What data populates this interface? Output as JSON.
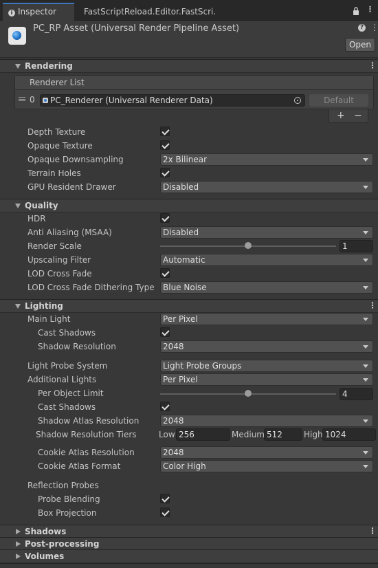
{
  "tabs": [
    {
      "label": "Inspector",
      "active": true
    },
    {
      "label": "FastScriptReload.Editor.FastScri.",
      "active": false
    }
  ],
  "header": {
    "title": "PC_RP Asset (Universal Render Pipeline Asset)",
    "open_label": "Open",
    "help_icon": "?",
    "menu_icon": "⋮"
  },
  "icons": {
    "info": "i",
    "lock": "🔒",
    "more": "⋮",
    "plus": "+",
    "minus": "−"
  },
  "rendering": {
    "title": "Rendering",
    "renderer_list_label": "Renderer List",
    "renderer_index": "0",
    "renderer_value": "PC_Renderer (Universal Renderer Data)",
    "default_label": "Default",
    "depth_texture_label": "Depth Texture",
    "depth_texture": true,
    "opaque_texture_label": "Opaque Texture",
    "opaque_texture": true,
    "opaque_downsampling_label": "Opaque Downsampling",
    "opaque_downsampling": "2x Bilinear",
    "terrain_holes_label": "Terrain Holes",
    "terrain_holes": true,
    "gpu_drawer_label": "GPU Resident Drawer",
    "gpu_drawer": "Disabled"
  },
  "quality": {
    "title": "Quality",
    "hdr_label": "HDR",
    "hdr": true,
    "msaa_label": "Anti Aliasing (MSAA)",
    "msaa": "Disabled",
    "render_scale_label": "Render Scale",
    "render_scale": "1",
    "render_scale_fraction": 0.5,
    "upscaling_label": "Upscaling Filter",
    "upscaling": "Automatic",
    "lod_cf_label": "LOD Cross Fade",
    "lod_cf": true,
    "lod_dither_label": "LOD Cross Fade Dithering Type",
    "lod_dither": "Blue Noise"
  },
  "lighting": {
    "title": "Lighting",
    "main_light_label": "Main Light",
    "main_light": "Per Pixel",
    "main_cast_shadows_label": "Cast Shadows",
    "main_cast_shadows": true,
    "shadow_resolution_label": "Shadow Resolution",
    "shadow_resolution": "2048",
    "probe_system_label": "Light Probe System",
    "probe_system": "Light Probe Groups",
    "additional_lights_label": "Additional Lights",
    "additional_lights": "Per Pixel",
    "per_object_limit_label": "Per Object Limit",
    "per_object_limit": "4",
    "per_object_limit_fraction": 0.5,
    "add_cast_shadows_label": "Cast Shadows",
    "add_cast_shadows": true,
    "atlas_res_label": "Shadow Atlas Resolution",
    "atlas_res": "2048",
    "tiers_label": "Shadow Resolution Tiers",
    "tier_low_label": "Low",
    "tier_low": "256",
    "tier_medium_label": "Medium",
    "tier_medium": "512",
    "tier_high_label": "High",
    "tier_high": "1024",
    "cookie_res_label": "Cookie Atlas Resolution",
    "cookie_res": "2048",
    "cookie_format_label": "Cookie Atlas Format",
    "cookie_format": "Color High",
    "reflection_label": "Reflection Probes",
    "probe_blending_label": "Probe Blending",
    "probe_blending": true,
    "box_projection_label": "Box Projection",
    "box_projection": true
  },
  "collapsed_sections": {
    "shadows": "Shadows",
    "post": "Post-processing",
    "volumes": "Volumes"
  }
}
